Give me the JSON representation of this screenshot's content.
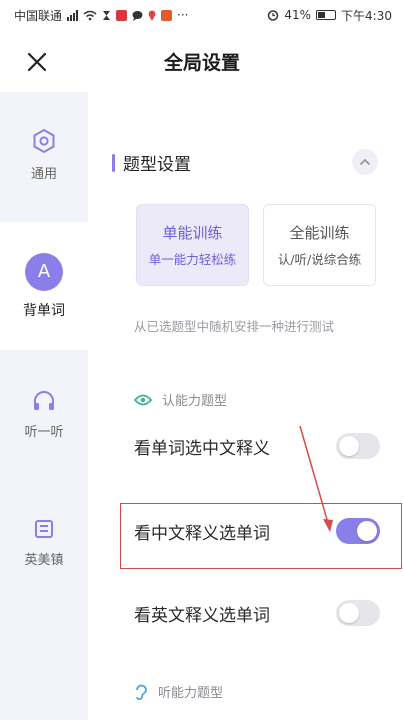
{
  "status_bar": {
    "carrier": "中国联通",
    "battery": "41%",
    "time": "下午4:30"
  },
  "header": {
    "title": "全局设置"
  },
  "sidebar": {
    "items": [
      {
        "label": "通用",
        "icon": "hexagon-settings-icon"
      },
      {
        "label": "背单词",
        "icon": "letter-a-avatar",
        "avatar_letter": "A",
        "active": true
      },
      {
        "label": "听一听",
        "icon": "headphones-icon"
      },
      {
        "label": "英美镇",
        "icon": "frame-icon"
      }
    ]
  },
  "main": {
    "section_title": "题型设置",
    "modes": [
      {
        "title": "单能训练",
        "subtitle": "单一能力轻松练",
        "selected": true
      },
      {
        "title": "全能训练",
        "subtitle": "认/听/说综合练",
        "selected": false
      }
    ],
    "description": "从已选题型中随机安排一种进行测试",
    "subsections": [
      {
        "title": "认能力题型",
        "icon": "eye-icon"
      },
      {
        "title": "听能力题型",
        "icon": "ear-icon"
      }
    ],
    "settings": [
      {
        "label": "看单词选中文释义",
        "enabled": false
      },
      {
        "label": "看中文释义选单词",
        "enabled": true
      },
      {
        "label": "看英文释义选单词",
        "enabled": false
      }
    ]
  },
  "colors": {
    "accent": "#8a7fe8",
    "annotation": "#d94b4b",
    "sidebar_bg": "#f3f4f9"
  }
}
